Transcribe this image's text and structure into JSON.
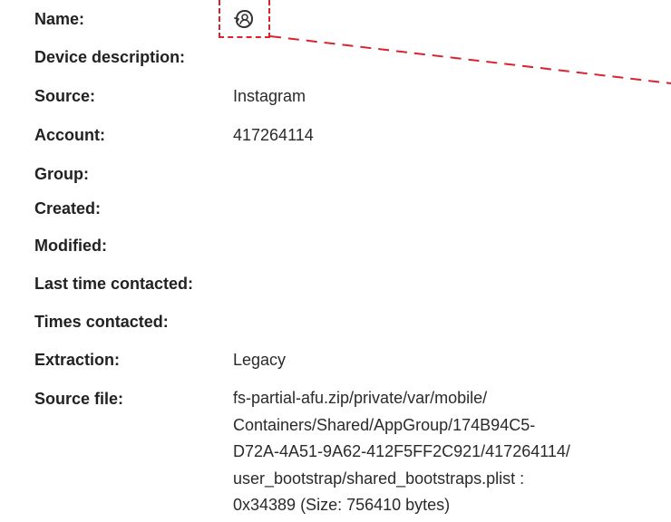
{
  "details": {
    "name": {
      "label": "Name:",
      "value": "",
      "icon": "avatar-icon"
    },
    "device_description": {
      "label": "Device description:",
      "value": ""
    },
    "source": {
      "label": "Source:",
      "value": "Instagram"
    },
    "account": {
      "label": "Account:",
      "value": "417264114"
    },
    "group": {
      "label": "Group:",
      "value": ""
    },
    "created": {
      "label": "Created:",
      "value": ""
    },
    "modified": {
      "label": "Modified:",
      "value": ""
    },
    "last_time_contacted": {
      "label": "Last time contacted:",
      "value": ""
    },
    "times_contacted": {
      "label": "Times contacted:",
      "value": ""
    },
    "extraction": {
      "label": "Extraction:",
      "value": "Legacy"
    },
    "source_file": {
      "label": "Source file:",
      "lines": [
        "fs-partial-afu.zip/private/var/mobile/",
        "Containers/Shared/AppGroup/174B94C5-",
        "D72A-4A51-9A62-412F5FF2C921/417264114/",
        "user_bootstrap/shared_bootstraps.plist :",
        "0x34389 (Size: 756410 bytes)"
      ]
    }
  },
  "colors": {
    "highlight": "#d9232f",
    "label_text": "#222222",
    "value_text": "#2a2a2a"
  }
}
